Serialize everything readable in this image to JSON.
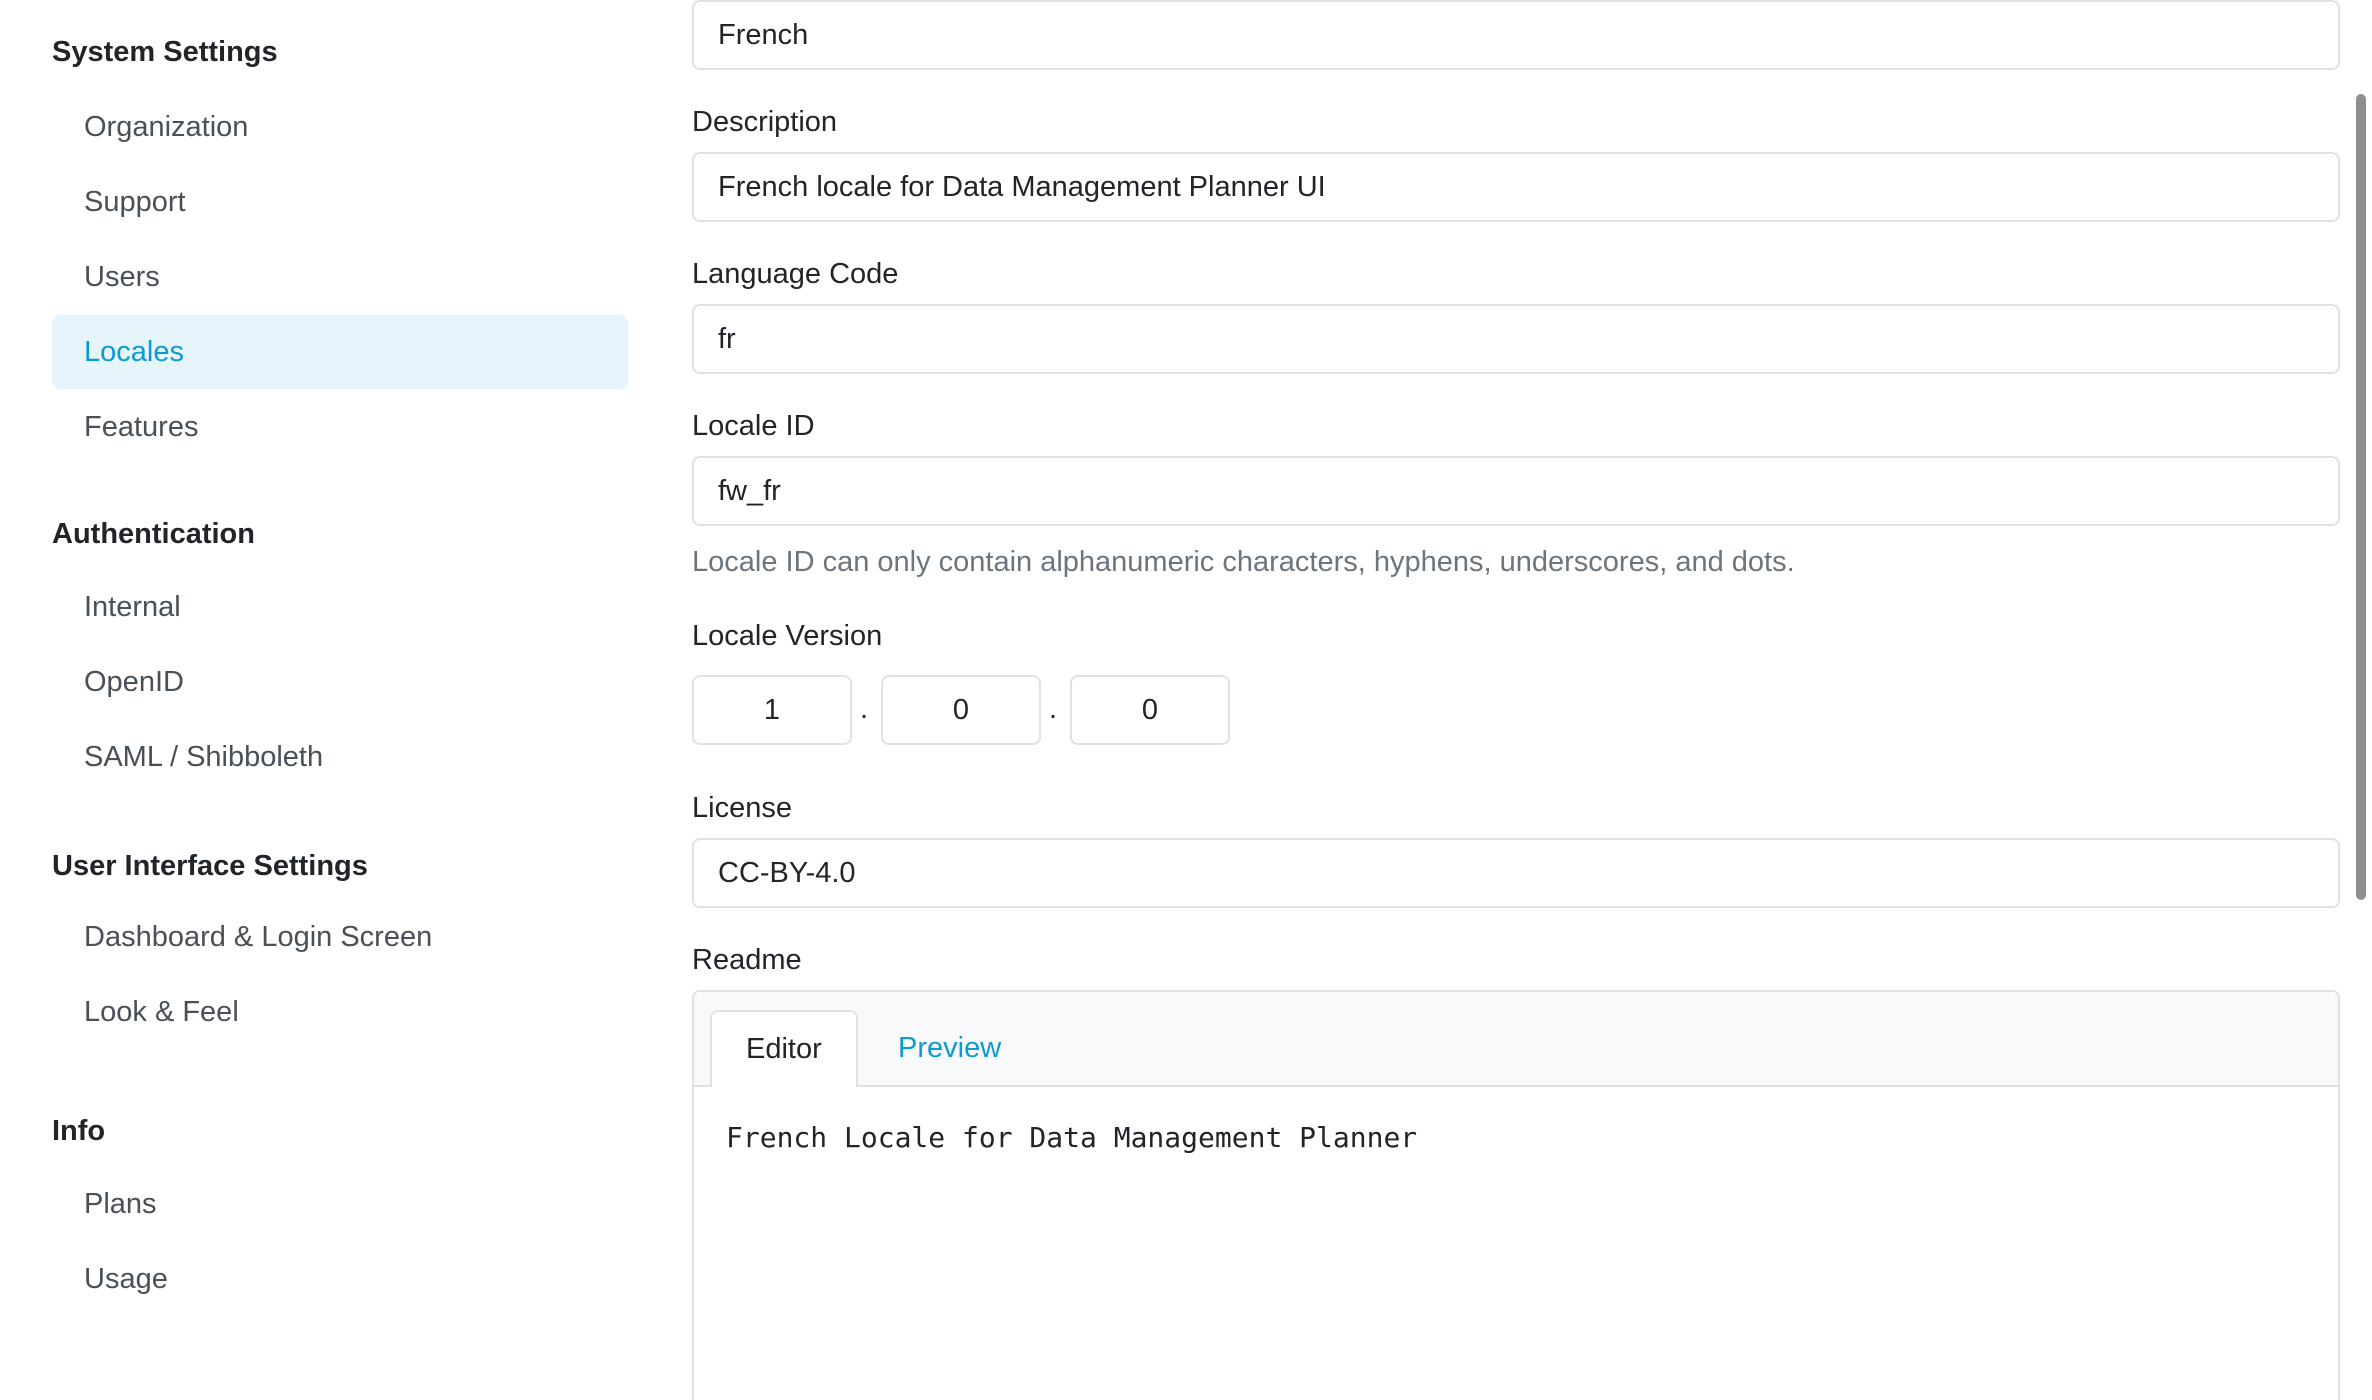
{
  "sidebar": {
    "sections": [
      {
        "title": "System Settings",
        "items": [
          "Organization",
          "Support",
          "Users",
          "Locales",
          "Features"
        ]
      },
      {
        "title": "Authentication",
        "items": [
          "Internal",
          "OpenID",
          "SAML / Shibboleth"
        ]
      },
      {
        "title": "User Interface Settings",
        "items": [
          "Dashboard & Login Screen",
          "Look & Feel"
        ]
      },
      {
        "title": "Info",
        "items": [
          "Plans",
          "Usage"
        ]
      }
    ],
    "active_item": "Locales"
  },
  "form": {
    "name_value": "French",
    "description": {
      "label": "Description",
      "value": "French locale for Data Management Planner UI"
    },
    "language_code": {
      "label": "Language Code",
      "value": "fr"
    },
    "locale_id": {
      "label": "Locale ID",
      "value": "fw_fr",
      "help": "Locale ID can only contain alphanumeric characters, hyphens, underscores, and dots."
    },
    "locale_version": {
      "label": "Locale Version",
      "major": "1",
      "minor": "0",
      "patch": "0",
      "separator": "."
    },
    "license": {
      "label": "License",
      "value": "CC-BY-4.0"
    },
    "readme": {
      "label": "Readme",
      "tab_editor": "Editor",
      "tab_preview": "Preview",
      "content": "French Locale for Data Management Planner"
    }
  },
  "colors": {
    "accent": "#0d9ad1",
    "active_bg": "#e6f4fb",
    "border": "#dee2e6",
    "muted_text": "#6c757d"
  }
}
